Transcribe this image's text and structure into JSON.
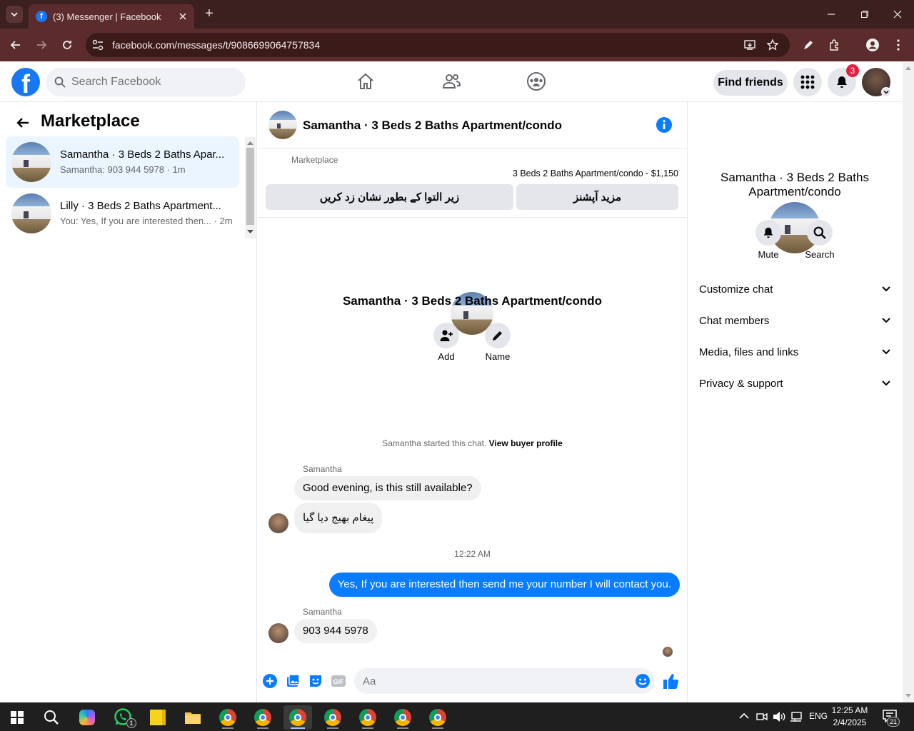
{
  "browser": {
    "tab_title": "(3) Messenger | Facebook",
    "new_tab": "+",
    "url": "facebook.com/messages/t/9086699064757834"
  },
  "fbnav": {
    "search_placeholder": "Search Facebook",
    "find_friends": "Find friends",
    "notif_count": "3"
  },
  "left": {
    "title": "Marketplace",
    "conversations": [
      {
        "name": "Samantha · 3 Beds 2 Baths Apar...",
        "preview": "Samantha: 903 944 5978 · 1m"
      },
      {
        "name": "Lilly · 3 Beds 2 Baths Apartment...",
        "preview": "You: Yes, If you are interested then... · 2m"
      }
    ]
  },
  "chat": {
    "header_name": "Samantha · 3 Beds 2 Baths Apartment/condo",
    "marketplace_label": "Marketplace",
    "listing": "3 Beds 2 Baths Apartment/condo - $1,150",
    "btn_mark_pending": "زیر التوا کے بطور نشان زد کریں",
    "btn_more_options": "مزید آپشنز",
    "profile_name": "Samantha · 3 Beds 2 Baths Apartment/condo",
    "add_label": "Add",
    "name_label": "Name",
    "started_text": "Samantha started this chat.",
    "view_buyer": "View buyer profile",
    "sender1": "Samantha",
    "msg1": "Good evening, is this still available?",
    "msg2": "پیغام بھیج دیا گیا",
    "timestamp": "12:22 AM",
    "msg_out": "Yes, If you are interested then send me your number I will contact you.",
    "sender2": "Samantha",
    "msg3": "903 944 5978",
    "composer_placeholder": "Aa"
  },
  "right": {
    "name": "Samantha · 3 Beds 2 Baths Apartment/condo",
    "mute": "Mute",
    "search": "Search",
    "rows": [
      "Customize chat",
      "Chat members",
      "Media, files and links",
      "Privacy & support"
    ]
  },
  "taskbar": {
    "whatsapp_badge": "1",
    "lang": "ENG",
    "time": "12:25 AM",
    "date": "2/4/2025",
    "notif_count": "21"
  },
  "colors": {
    "fb_blue": "#1877f2",
    "outgoing_bubble": "#0a7cff",
    "browser_frame": "#5c2c2c"
  }
}
